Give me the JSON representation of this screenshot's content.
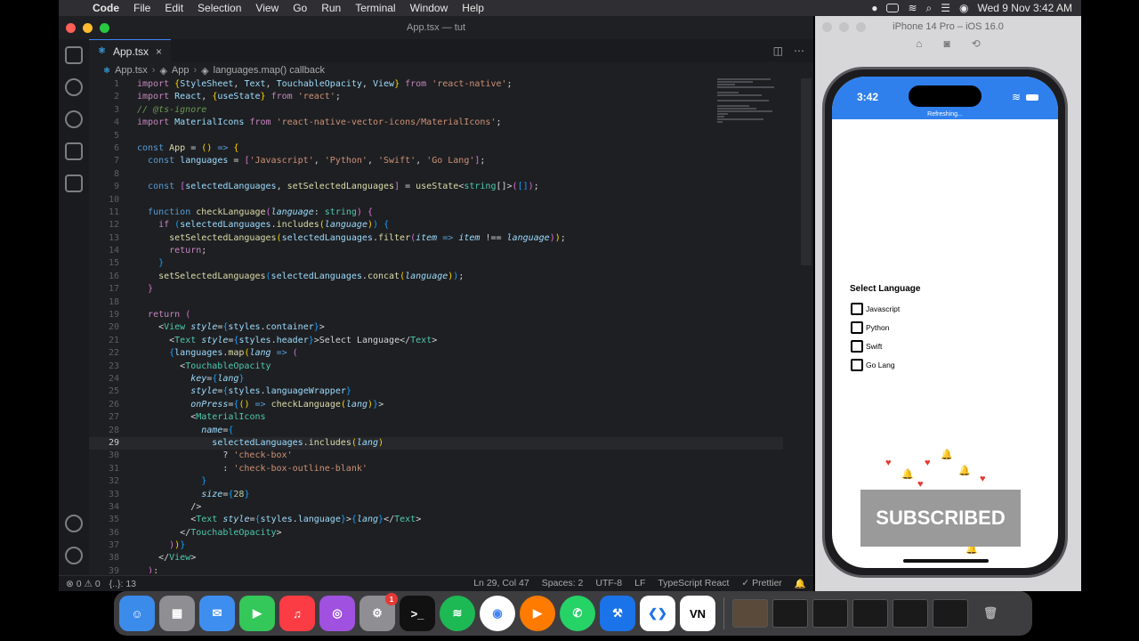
{
  "menubar": {
    "app": "Code",
    "items": [
      "File",
      "Edit",
      "Selection",
      "View",
      "Go",
      "Run",
      "Terminal",
      "Window",
      "Help"
    ],
    "datetime": "Wed 9 Nov  3:42 AM"
  },
  "window": {
    "title": "App.tsx — tut"
  },
  "tab": {
    "label": "App.tsx",
    "close": "×"
  },
  "breadcrumb": {
    "file": "App.tsx",
    "component": "App",
    "symbol": "languages.map() callback"
  },
  "editor": {
    "active_line": 29
  },
  "statusbar": {
    "errors": "0",
    "warnings": "0",
    "selection": "{..}: 13",
    "position": "Ln 29, Col 47",
    "spaces": "Spaces: 2",
    "encoding": "UTF-8",
    "eol": "LF",
    "language": "TypeScript React",
    "formatter": "✓ Prettier"
  },
  "simulator": {
    "title": "iPhone 14 Pro – iOS 16.0",
    "time": "3:42",
    "refreshing": "Refreshing...",
    "header": "Select Language",
    "languages": [
      "Javascript",
      "Python",
      "Swift",
      "Go Lang"
    ],
    "overlay": "SUBSCRIBED"
  },
  "dock": {
    "apps": [
      {
        "name": "finder",
        "color": "#3b8beb"
      },
      {
        "name": "launchpad",
        "color": "#8e8e93"
      },
      {
        "name": "mail",
        "color": "#3e8ef0"
      },
      {
        "name": "facetime",
        "color": "#34c759"
      },
      {
        "name": "music",
        "color": "#fc3c44"
      },
      {
        "name": "podcasts",
        "color": "#a051e0"
      },
      {
        "name": "system-preferences",
        "color": "#8e8e93",
        "badge": "1"
      },
      {
        "name": "terminal",
        "color": "#111111"
      },
      {
        "name": "spotify",
        "color": "#1db954"
      },
      {
        "name": "chrome",
        "color": "#ffffff"
      },
      {
        "name": "infuse",
        "color": "#ff7b00"
      },
      {
        "name": "whatsapp",
        "color": "#25d366"
      },
      {
        "name": "xcode",
        "color": "#1a73e8"
      },
      {
        "name": "vscode",
        "color": "#ffffff"
      },
      {
        "name": "vn-editor",
        "color": "#ffffff"
      }
    ]
  }
}
